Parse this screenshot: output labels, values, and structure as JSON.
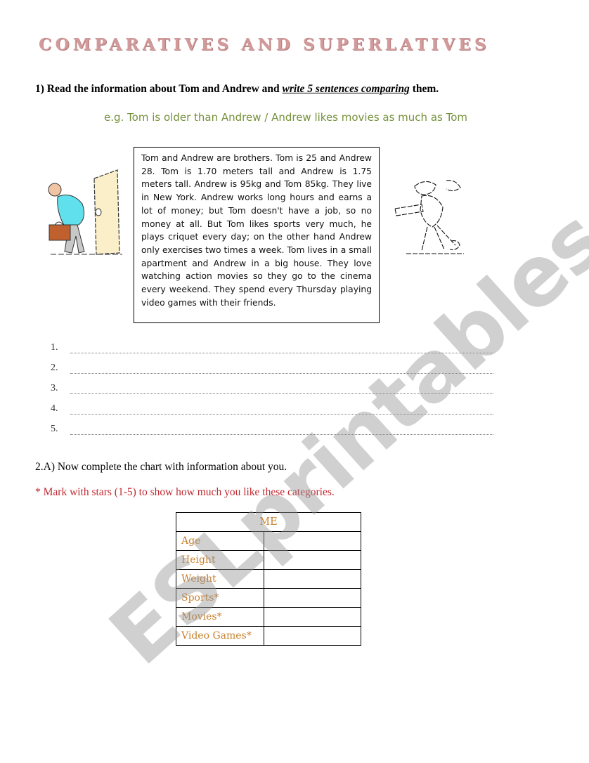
{
  "worksheet": {
    "title": "COMPARATIVES AND SUPERLATIVES",
    "exercise1": {
      "prefix": "1) Read the information about Tom and Andrew and ",
      "emphasis": "write 5 sentences comparing",
      "suffix": " them.",
      "example": "e.g. Tom is older than Andrew / Andrew likes movies as much as Tom",
      "passage": "Tom and Andrew are brothers. Tom is 25 and Andrew 28. Tom is 1.70 meters tall and Andrew is 1.75 meters tall. Andrew is 95kg and Tom 85kg. They live in New York. Andrew works long hours and earns a lot of money; but Tom doesn't have a job, so no money at all. But Tom likes sports very much, he plays criquet every day; on the other hand Andrew only exercises two times a week. Tom lives in a small apartment and Andrew in a big house. They love watching action movies so they go to the cinema every weekend. They spend every Thursday playing video games with their friends.",
      "images": {
        "left": "man-with-briefcase-at-door-illustration",
        "right": "man-playing-cricket-illustration"
      },
      "answer_lines": [
        {
          "number": "1.",
          "value": ""
        },
        {
          "number": "2.",
          "value": ""
        },
        {
          "number": "3.",
          "value": ""
        },
        {
          "number": "4.",
          "value": ""
        },
        {
          "number": "5.",
          "value": ""
        }
      ]
    },
    "exercise2": {
      "instruction": "2.A) Now complete the chart with information about you.",
      "note": "* Mark with stars (1-5) to show how much you like these categories.",
      "table": {
        "header": "ME",
        "rows": [
          {
            "label": "Age",
            "value": ""
          },
          {
            "label": "Height",
            "value": ""
          },
          {
            "label": "Weight",
            "value": ""
          },
          {
            "label": "Sports*",
            "value": ""
          },
          {
            "label": "Movies*",
            "value": ""
          },
          {
            "label": "Video Games*",
            "value": ""
          }
        ]
      }
    },
    "watermark": "ESLprintables.com"
  },
  "colors": {
    "title": "#d29a9a",
    "example": "#76923c",
    "note": "#c0282f",
    "table_text": "#c8802c"
  }
}
